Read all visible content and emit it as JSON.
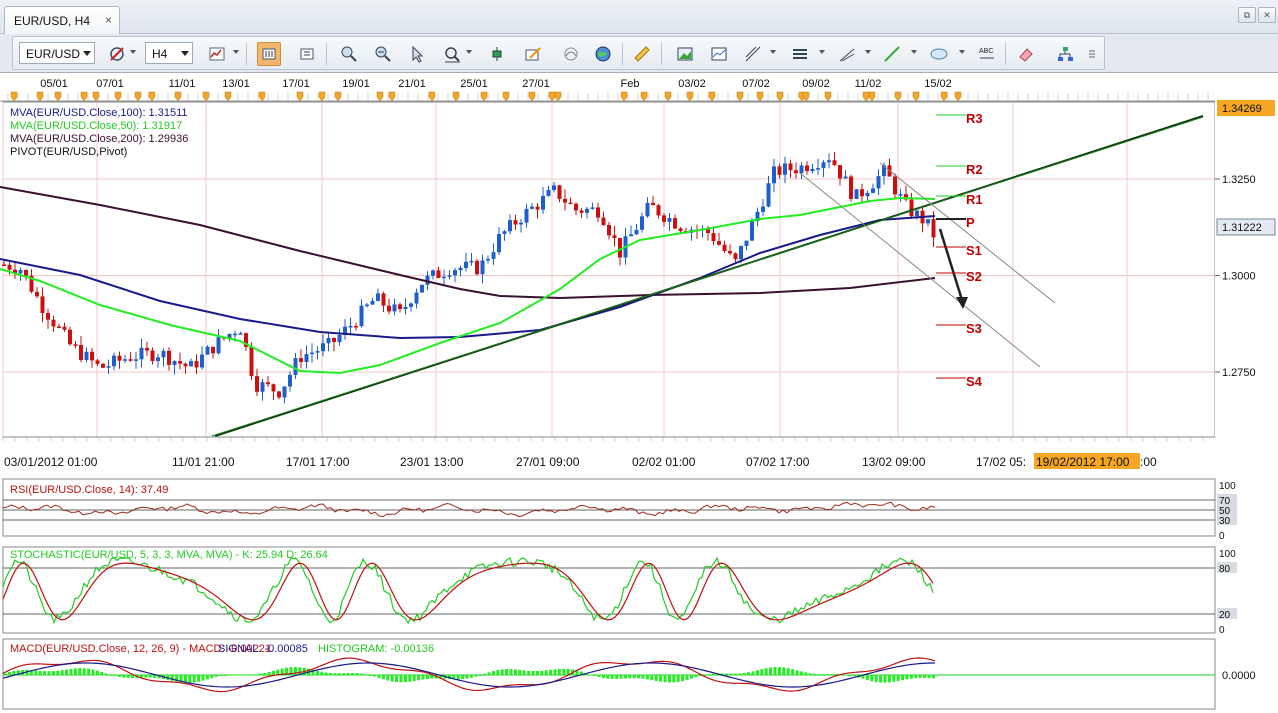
{
  "tab": {
    "title": "EUR/USD, H4",
    "close": "×"
  },
  "window": {
    "restore": "⧉",
    "close": "✕"
  },
  "toolbar": {
    "symbol": "EUR/USD",
    "timeframe": "H4",
    "icons": [
      "candle-type-icon",
      "bar-chart-icon",
      "chart-settings-icon",
      "zoom-in-icon",
      "zoom-out-icon",
      "crosshair-icon",
      "zoom-fit-icon",
      "indicators-icon",
      "objects-icon",
      "wave-icon",
      "globe-icon",
      "ruler-icon",
      "picture-icon",
      "template-icon",
      "drawing-tools-icon",
      "horizontal-lines-icon",
      "trendline-icon",
      "line-tool-icon",
      "ellipse-icon",
      "text-tool-icon",
      "eraser-icon",
      "hierarchy-icon",
      "more-icon"
    ]
  },
  "top_dates": [
    "05/01",
    "07/01",
    "11/01",
    "13/01",
    "17/01",
    "19/01",
    "21/01",
    "25/01",
    "27/01",
    "Feb",
    "03/02",
    "07/02",
    "09/02",
    "11/02",
    "15/02"
  ],
  "bottom_dates": [
    "03/01/2012 01:00",
    "11/01 21:00",
    "17/01 17:00",
    "23/01 13:00",
    "27/01 09:00",
    "02/02 01:00",
    "07/02 17:00",
    "13/02 09:00",
    "17/02 05:",
    "19/02/2012 17:00",
    ":00"
  ],
  "legend": [
    {
      "text": "MVA(EUR/USD.Close,100): 1.31511",
      "color": "#1a1a8c"
    },
    {
      "text": "MVA(EUR/USD.Close,50): 1.31917",
      "color": "#22cc22"
    },
    {
      "text": "MVA(EUR/USD.Close,200): 1.29936",
      "color": "#3a1030"
    },
    {
      "text": "PIVOT(EUR/USD,Pivot)",
      "color": "#111111"
    }
  ],
  "pivots": [
    "R3",
    "R2",
    "R1",
    "P",
    "S1",
    "S2",
    "S3",
    "S4"
  ],
  "price_axis": {
    "current": "1.34269",
    "last": "1.31222",
    "ticks": [
      "1.3250",
      "1.3000",
      "1.2750"
    ]
  },
  "rsi": {
    "label": "RSI(EUR/USD.Close, 14): 37.49",
    "levels": [
      "100",
      "70",
      "50",
      "30",
      "0"
    ]
  },
  "stoch": {
    "label": "STOCHASTIC(EUR/USD, 5, 3, 3, MVA, MVA) -  K: 25.94  D: 26.64",
    "levels": [
      "100",
      "80",
      "20",
      "0"
    ]
  },
  "macd": {
    "label1": "MACD(EUR/USD.Close, 12, 26, 9) -  MACD: -0.00221",
    "label2": "SIGNAL: -0.00085",
    "label3": "HISTOGRAM: -0.00136",
    "zero": "0.0000"
  },
  "colors": {
    "green": "#22dd22",
    "red": "#cc0000",
    "blue": "#1a1a8c",
    "candle_up": "#1f5fcc",
    "candle_down": "#cc1010",
    "accent": "#f5a623"
  }
}
